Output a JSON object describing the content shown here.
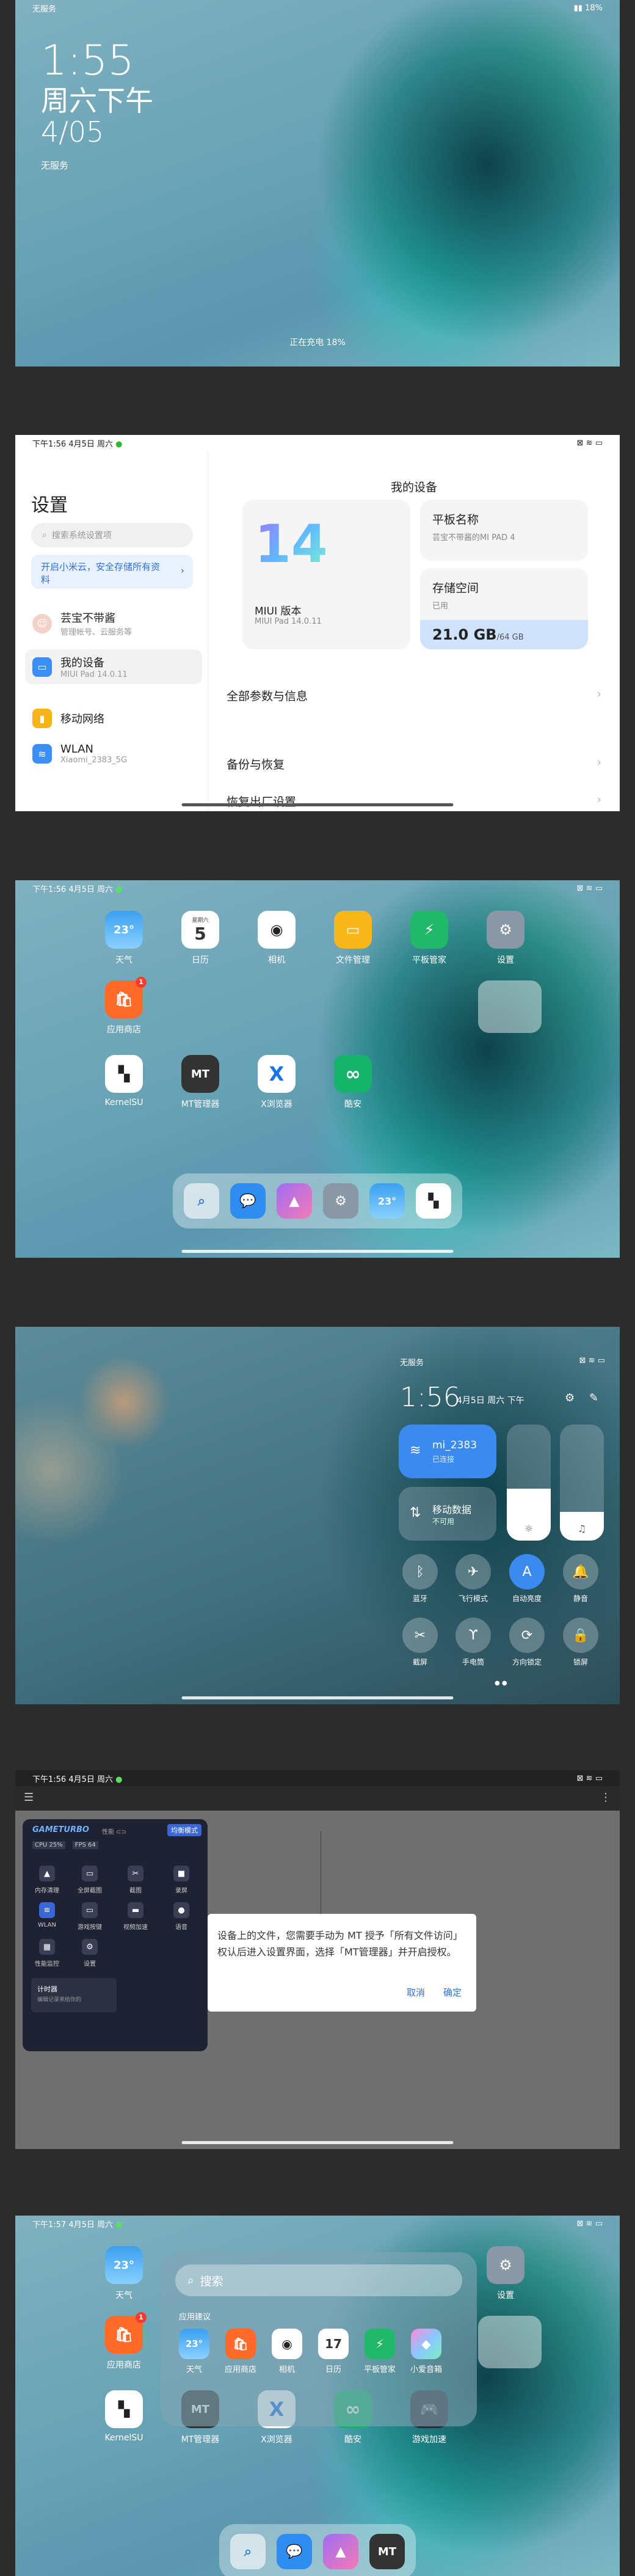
{
  "lock": {
    "status_left": "无服务",
    "status_right": "▮▮ 18%",
    "time": "1:55",
    "date_line1": "周六下午",
    "date_line2": "4/05",
    "service": "无服务",
    "charging": "正在充电 18%"
  },
  "settings": {
    "status_time": "下午1:56 4月5日 周六",
    "status_right": "⊠ ≋ ▭",
    "title": "设置",
    "search_placeholder": "搜索系统设置项",
    "promo": "开启小米云，安全存储所有资料",
    "rows": [
      {
        "title": "芸宝不带酱",
        "sub": "管理帐号、云服务等"
      },
      {
        "title": "我的设备",
        "sub": "MIUI Pad 14.0.11"
      },
      {
        "title": "移动网络",
        "sub": ""
      },
      {
        "title": "WLAN",
        "sub": "Xiaomi_2383_5G"
      }
    ],
    "device_header": "我的设备",
    "miui_logo": "14",
    "miui_label": "MIUI 版本",
    "miui_version": "MIUI Pad 14.0.11",
    "tablet_name_label": "平板名称",
    "tablet_name_value": "芸宝不带酱的MI PAD 4",
    "storage_label": "存储空间",
    "storage_sub": "已用",
    "storage_used": "21.0 GB",
    "storage_total": "/64 GB",
    "storage_used_fraction": 0.33,
    "rows_right": [
      "全部参数与信息",
      "备份与恢复",
      "恢复出厂设置"
    ]
  },
  "home": {
    "status_time": "下午1:56 4月5日 周六",
    "status_right": "⊠ ≋ ▭",
    "apps_row1": [
      {
        "label": "天气",
        "glyph": "23°",
        "icon": "weather-icon"
      },
      {
        "label": "日历",
        "glyph": "5",
        "icon": "calendar-icon"
      },
      {
        "label": "相机",
        "glyph": "◉",
        "icon": "camera-icon"
      },
      {
        "label": "文件管理",
        "glyph": "▭",
        "icon": "folder-icon"
      },
      {
        "label": "平板管家",
        "glyph": "⚡",
        "icon": "shield-icon"
      },
      {
        "label": "设置",
        "glyph": "⚙",
        "icon": "gear-icon"
      }
    ],
    "calendar_weekday": "星期六",
    "app_store": "应用商店",
    "app_store_badge": "1",
    "apps_row2": [
      {
        "label": "KernelSU",
        "glyph": "▚",
        "icon": "kernelsu-icon"
      },
      {
        "label": "MT管理器",
        "glyph": "MT",
        "icon": "mt-manager-icon"
      },
      {
        "label": "X浏览器",
        "glyph": "X",
        "icon": "x-browser-icon"
      },
      {
        "label": "酷安",
        "glyph": "∞",
        "icon": "coolapk-icon"
      }
    ],
    "dock": [
      {
        "glyph": "⌕",
        "icon": "search-icon"
      },
      {
        "glyph": "💬",
        "icon": "message-icon"
      },
      {
        "glyph": "▲",
        "icon": "gallery-icon"
      },
      {
        "glyph": "⚙",
        "icon": "settings-dock-icon"
      },
      {
        "glyph": "23°",
        "icon": "weather-dock-icon"
      },
      {
        "glyph": "▚",
        "icon": "kernelsu-dock-icon"
      }
    ]
  },
  "control_center": {
    "service": "无服务",
    "status_right": "⊠ ≋ ▭",
    "time": "1:56",
    "date": "4月5日 周六 下午",
    "wifi_name": "mi_2383",
    "wifi_sub": "已连接",
    "mobile_name": "移动数据",
    "mobile_sub": "不可用",
    "brightness_fraction": 0.45,
    "volume_fraction": 0.25,
    "buttons": [
      {
        "label": "蓝牙",
        "glyph": "ᛒ",
        "icon": "bluetooth-icon"
      },
      {
        "label": "飞行模式",
        "glyph": "✈",
        "icon": "airplane-icon"
      },
      {
        "label": "自动亮度",
        "glyph": "A",
        "icon": "auto-brightness-icon"
      },
      {
        "label": "静音",
        "glyph": "🔔",
        "icon": "mute-icon"
      },
      {
        "label": "截屏",
        "glyph": "✂",
        "icon": "screenshot-icon"
      },
      {
        "label": "手电筒",
        "glyph": "ϒ",
        "icon": "flashlight-icon"
      },
      {
        "label": "方向锁定",
        "glyph": "⟳",
        "icon": "rotation-lock-icon"
      },
      {
        "label": "锁屏",
        "glyph": "🔒",
        "icon": "lock-screen-icon"
      }
    ]
  },
  "gameturbo": {
    "status_time": "下午1:56 4月5日 周六",
    "status_right": "⊠ ≋ ▭",
    "logo": "GAMETURBO",
    "toggle_label": "性能",
    "mode_button": "均衡模式",
    "cpu": "CPU 25%",
    "fps": "FPS 64",
    "buttons": [
      {
        "label": "内存清理",
        "glyph": "▲",
        "icon": "memory-clean-icon"
      },
      {
        "label": "全屏截图",
        "glyph": "▭",
        "icon": "fullscreen-capture-icon"
      },
      {
        "label": "截图",
        "glyph": "✂",
        "icon": "screenshot-icon"
      },
      {
        "label": "录屏",
        "glyph": "■",
        "icon": "record-icon"
      },
      {
        "label": "WLAN",
        "glyph": "≋",
        "icon": "wlan-icon"
      },
      {
        "label": "游戏按键",
        "glyph": "▭",
        "icon": "game-keys-icon"
      },
      {
        "label": "视频加速",
        "glyph": "▬",
        "icon": "video-boost-icon"
      },
      {
        "label": "语音",
        "glyph": "●",
        "icon": "voice-icon"
      },
      {
        "label": "性能监控",
        "glyph": "▦",
        "icon": "monitor-icon"
      },
      {
        "label": "设置",
        "glyph": "⚙",
        "icon": "gear-icon"
      }
    ],
    "calc_title": "计时器",
    "calc_sub": "编辑记录来给你的",
    "dialog_text": "设备上的文件，您需要手动为 MT 授予「所有文件访问」权认后进入设置界面，选择「MT管理器」并开启授权。",
    "dialog_cancel": "取消",
    "dialog_ok": "确定"
  },
  "search_overlay": {
    "status_time": "下午1:57 4月5日 周六",
    "status_right": "⊠ ≋ ▭",
    "placeholder": "搜索",
    "suggest_label": "应用建议",
    "suggest_apps": [
      {
        "label": "天气",
        "glyph": "23°",
        "icon": "weather-icon"
      },
      {
        "label": "应用商店",
        "glyph": "🛍",
        "icon": "app-store-icon"
      },
      {
        "label": "相机",
        "glyph": "◉",
        "icon": "camera-icon"
      },
      {
        "label": "日历",
        "glyph": "17",
        "icon": "calendar-icon"
      },
      {
        "label": "平板管家",
        "glyph": "⚡",
        "icon": "shield-icon"
      },
      {
        "label": "小爱音箱",
        "glyph": "◆",
        "icon": "xiaoai-icon"
      }
    ],
    "row_top": [
      {
        "label": "天气",
        "glyph": "23°",
        "icon": "weather-icon"
      },
      {
        "label": "设置",
        "glyph": "⚙",
        "icon": "gear-icon"
      }
    ],
    "row_mid": [
      {
        "label": "应用商店",
        "glyph": "🛍",
        "icon": "app-store-icon"
      }
    ],
    "row_bottom": [
      {
        "label": "KernelSU",
        "glyph": "▚",
        "icon": "kernelsu-icon"
      },
      {
        "label": "MT管理器",
        "glyph": "MT",
        "icon": "mt-manager-icon"
      },
      {
        "label": "X浏览器",
        "glyph": "X",
        "icon": "x-browser-icon"
      },
      {
        "label": "酷安",
        "glyph": "∞",
        "icon": "coolapk-icon"
      },
      {
        "label": "游戏加速",
        "glyph": "🎮",
        "icon": "game-boost-icon"
      }
    ],
    "badge": "1"
  },
  "colors": {
    "accent": "#2f72d9",
    "bg": "#2c2c2c"
  }
}
